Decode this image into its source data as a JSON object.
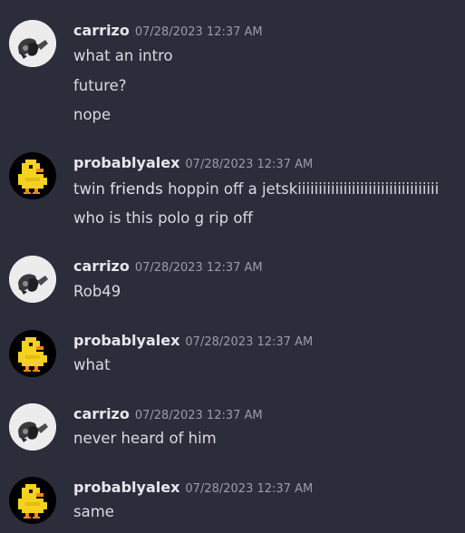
{
  "messages": [
    {
      "author": "carrizo",
      "avatar": "helmet-avatar-icon",
      "timestamp": "07/28/2023 12:37 AM",
      "lines": [
        "what an intro",
        "future?",
        "nope"
      ]
    },
    {
      "author": "probablyalex",
      "avatar": "pixel-duck-avatar-icon",
      "timestamp": "07/28/2023 12:37 AM",
      "line1_a": "twin ",
      "line1_b": "friends",
      "line1_c": " hoppin off a jetskiiiiiiiiiiiiiiiiiiiiiiiiiiiiiiiiii",
      "lines": [
        "who is this polo g rip off"
      ]
    },
    {
      "author": "carrizo",
      "avatar": "helmet-avatar-icon",
      "timestamp": "07/28/2023 12:37 AM",
      "lines": [
        "Rob49"
      ]
    },
    {
      "author": "probablyalex",
      "avatar": "pixel-duck-avatar-icon",
      "timestamp": "07/28/2023 12:37 AM",
      "lines": [
        "what"
      ]
    },
    {
      "author": "carrizo",
      "avatar": "helmet-avatar-icon",
      "timestamp": "07/28/2023 12:37 AM",
      "lines": [
        "never heard of him"
      ]
    },
    {
      "author": "probablyalex",
      "avatar": "pixel-duck-avatar-icon",
      "timestamp": "07/28/2023 12:37 AM",
      "lines": [
        "same"
      ]
    }
  ],
  "colors": {
    "background": "#2b2d3b",
    "username": "#e6e7ec",
    "timestamp": "#9a9ca8",
    "message_text": "#d9dae0",
    "duck_yellow": "#f5d21f"
  }
}
